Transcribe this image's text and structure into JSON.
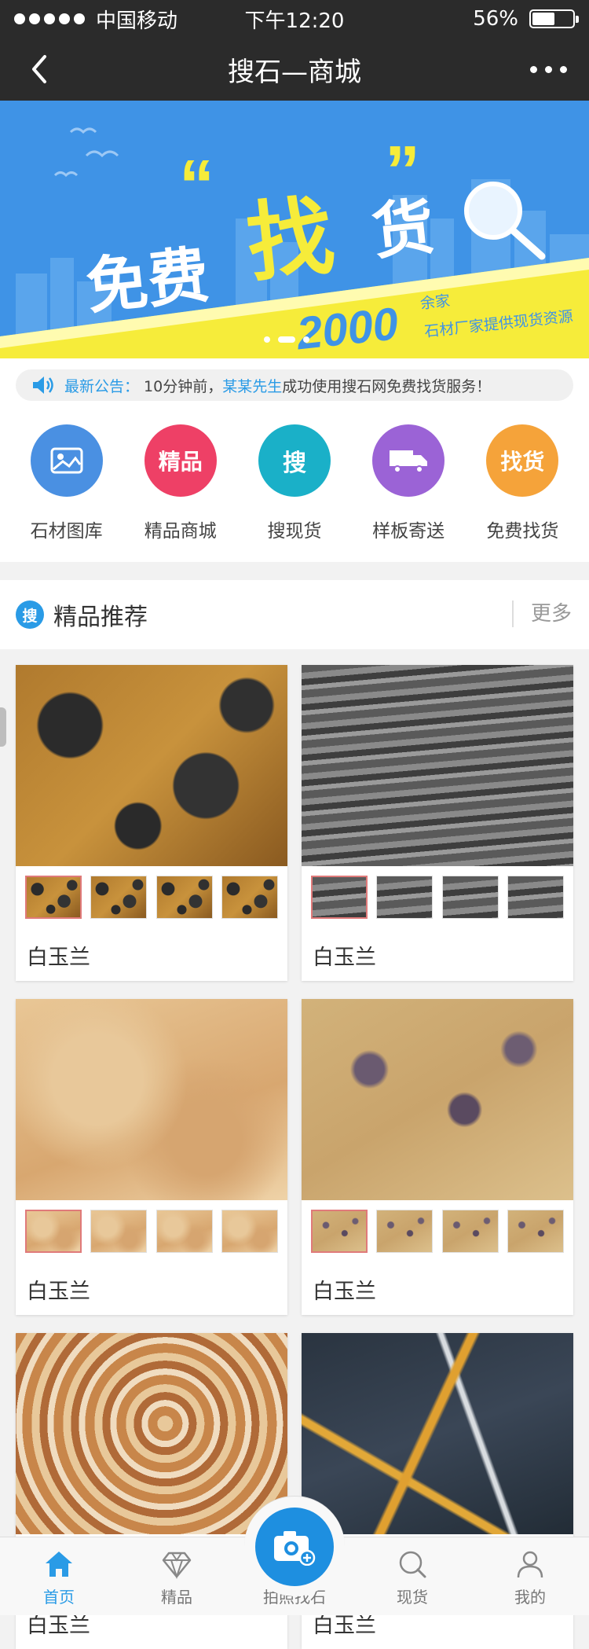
{
  "status": {
    "carrier": "中国移动",
    "time": "下午12:20",
    "battery": "56%",
    "battery_level": 0.56
  },
  "nav": {
    "title": "搜石—商城"
  },
  "banner": {
    "quote_left": "“",
    "word1": "免费",
    "word2": "找",
    "word3": "货",
    "quote_right": "”",
    "number": "2000",
    "unit": "余家",
    "sub": "石材厂家提供现货资源"
  },
  "notice": {
    "label": "最新公告：",
    "prefix": "10分钟前，",
    "name": "某某先生",
    "suffix": "成功使用搜石网免费找货服务！"
  },
  "icons": [
    {
      "label": "石材图库",
      "glyph": "",
      "color": "#4a90e2",
      "icon": "image-icon"
    },
    {
      "label": "精品商城",
      "glyph": "精品",
      "color": "#ee4066",
      "icon": "jingpin-icon"
    },
    {
      "label": "搜现货",
      "glyph": "搜",
      "color": "#1ab0c8",
      "icon": "search-stock-icon"
    },
    {
      "label": "样板寄送",
      "glyph": "",
      "color": "#9b63d6",
      "icon": "truck-icon"
    },
    {
      "label": "免费找货",
      "glyph": "找货",
      "color": "#f5a33a",
      "icon": "find-goods-icon"
    }
  ],
  "section": {
    "icon_text": "搜",
    "title": "精品推荐",
    "more": "更多"
  },
  "products": [
    {
      "name": "白玉兰",
      "palette": "gold-black"
    },
    {
      "name": "白玉兰",
      "palette": "grey"
    },
    {
      "name": "白玉兰",
      "palette": "beige"
    },
    {
      "name": "白玉兰",
      "palette": "tan-purple"
    },
    {
      "name": "白玉兰",
      "palette": "onyx"
    },
    {
      "name": "白玉兰",
      "palette": "black-gold"
    }
  ],
  "tabs": [
    {
      "label": "首页",
      "icon": "home-icon",
      "active": true
    },
    {
      "label": "精品",
      "icon": "diamond-icon",
      "active": false
    },
    {
      "label": "拍照找石",
      "icon": "camera-icon",
      "active": false
    },
    {
      "label": "现货",
      "icon": "search-icon",
      "active": false
    },
    {
      "label": "我的",
      "icon": "user-icon",
      "active": false
    }
  ],
  "colors": {
    "accent": "#2a9be6",
    "bar": "#2b2b2b",
    "banner_blue": "#3f93e6",
    "banner_yellow": "#f6ec3a"
  }
}
